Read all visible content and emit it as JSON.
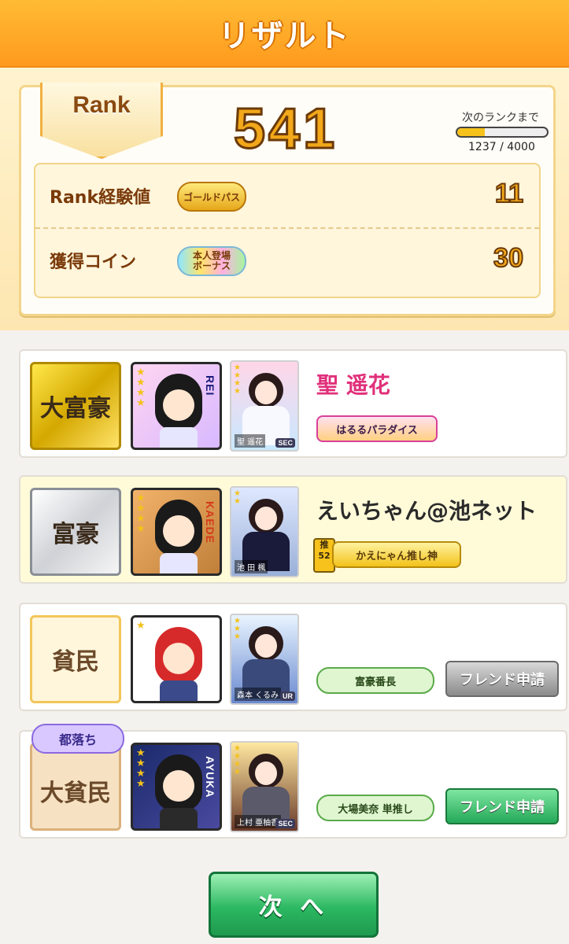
{
  "header": {
    "title": "リザルト"
  },
  "rank": {
    "label": "Rank",
    "value": "541",
    "next_label": "次のランクまで",
    "progress_current": 1237,
    "progress_max": 4000,
    "progress_text": "1237 / 4000"
  },
  "stats": [
    {
      "label": "Rank経験値",
      "badge": "ゴールドパス",
      "badge_sub": "",
      "value": "11"
    },
    {
      "label": "獲得コイン",
      "badge": "本人登場",
      "badge_sub": "ボーナス",
      "value": "30"
    }
  ],
  "players": [
    {
      "status": "大富豪",
      "avatar_name": "REI",
      "card_name": "聖 遥花",
      "card_rarity": "SEC",
      "name": "聖 遥花",
      "title": "はるるパラダイス",
      "oshi_level": "",
      "friend_button": "",
      "tag": ""
    },
    {
      "status": "富豪",
      "avatar_name": "KAEDE",
      "card_name": "池 田 楓",
      "card_rarity": "",
      "name": "えいちゃん@池ネット",
      "title": "かえにゃん推し神",
      "oshi_level": "52",
      "oshi_label": "推",
      "friend_button": "",
      "tag": ""
    },
    {
      "status": "貧民",
      "avatar_name": "",
      "card_name": "森本 くるみ",
      "card_rarity": "UR",
      "name": "",
      "title": "富豪番長",
      "oshi_level": "",
      "friend_button": "フレンド申請",
      "tag": ""
    },
    {
      "status": "大貧民",
      "avatar_name": "AYUKA",
      "card_name": "上村 亜柚香",
      "card_rarity": "SEC",
      "name": "",
      "title": "大場美奈 単推し",
      "oshi_level": "",
      "friend_button": "フレンド申請",
      "tag": "都落ち"
    }
  ],
  "footer": {
    "next_button": "次 へ"
  },
  "colors": {
    "header": "#ff9a1f",
    "accent_gold": "#f2a81a",
    "button_green": "#2cb862"
  }
}
